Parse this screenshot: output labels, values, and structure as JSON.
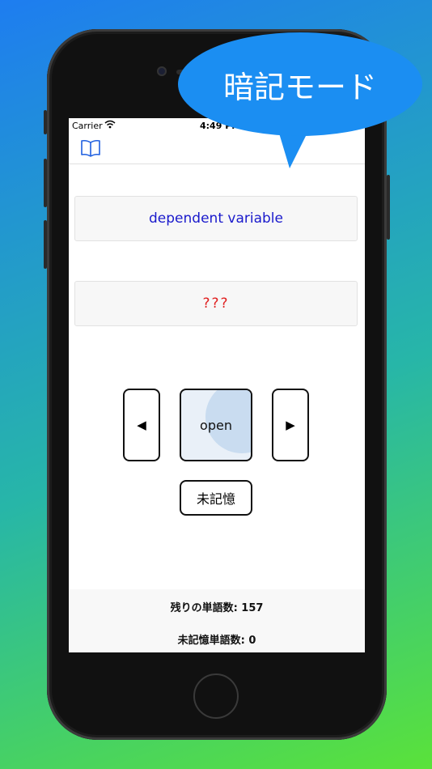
{
  "callout": {
    "text": "暗記モード"
  },
  "status_bar": {
    "carrier": "Carrier",
    "time": "4:49 PM"
  },
  "nav": {
    "icon": "book-icon"
  },
  "card": {
    "word": "dependent variable",
    "answer": "???"
  },
  "controls": {
    "prev_label": "◀",
    "open_label": "open",
    "next_label": "▶",
    "unmemorized_label": "未記憶"
  },
  "stats": {
    "remaining": "残りの単語数: 157",
    "unmemorized": "未記憶単語数: 0"
  },
  "colors": {
    "word": "#1a1acc",
    "answer": "#e02020",
    "bubble": "#1b8ef2",
    "open_button_bg": "#e9f0f8"
  }
}
